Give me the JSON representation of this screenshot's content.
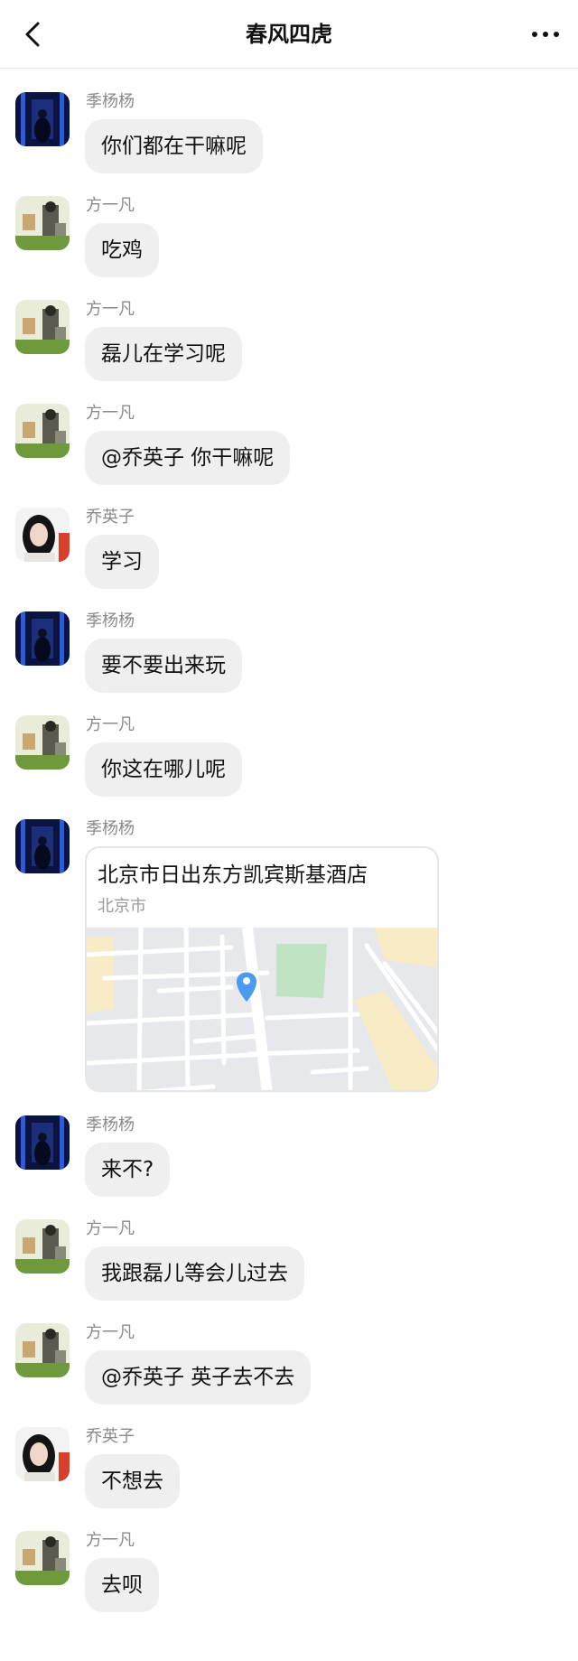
{
  "header": {
    "title": "春风四虎",
    "back_icon": "chevron-left-icon",
    "more_icon": "more-horizontal-icon"
  },
  "messages": [
    {
      "sender": "季杨杨",
      "text": "你们都在干嘛呢"
    },
    {
      "sender": "方一凡",
      "text": "吃鸡"
    },
    {
      "sender": "方一凡",
      "text": "磊儿在学习呢"
    },
    {
      "sender": "方一凡",
      "text": "@乔英子 你干嘛呢"
    },
    {
      "sender": "乔英子",
      "text": "学习"
    },
    {
      "sender": "季杨杨",
      "text": "要不要出来玩"
    },
    {
      "sender": "方一凡",
      "text": "你这在哪儿呢"
    },
    {
      "sender": "季杨杨",
      "location": {
        "title": "北京市日出东方凯宾斯基酒店",
        "subtitle": "北京市"
      }
    },
    {
      "sender": "季杨杨",
      "text": "来不?"
    },
    {
      "sender": "方一凡",
      "text": "我跟磊儿等会儿过去"
    },
    {
      "sender": "方一凡",
      "text": "@乔英子 英子去不去"
    },
    {
      "sender": "乔英子",
      "text": "不想去"
    },
    {
      "sender": "方一凡",
      "text": "去呗"
    }
  ],
  "colors": {
    "bubble_bg": "#efefef",
    "sender_text": "#8a8a8a",
    "map_pin": "#4a9af0",
    "map_bg": "#e6e8ec"
  }
}
